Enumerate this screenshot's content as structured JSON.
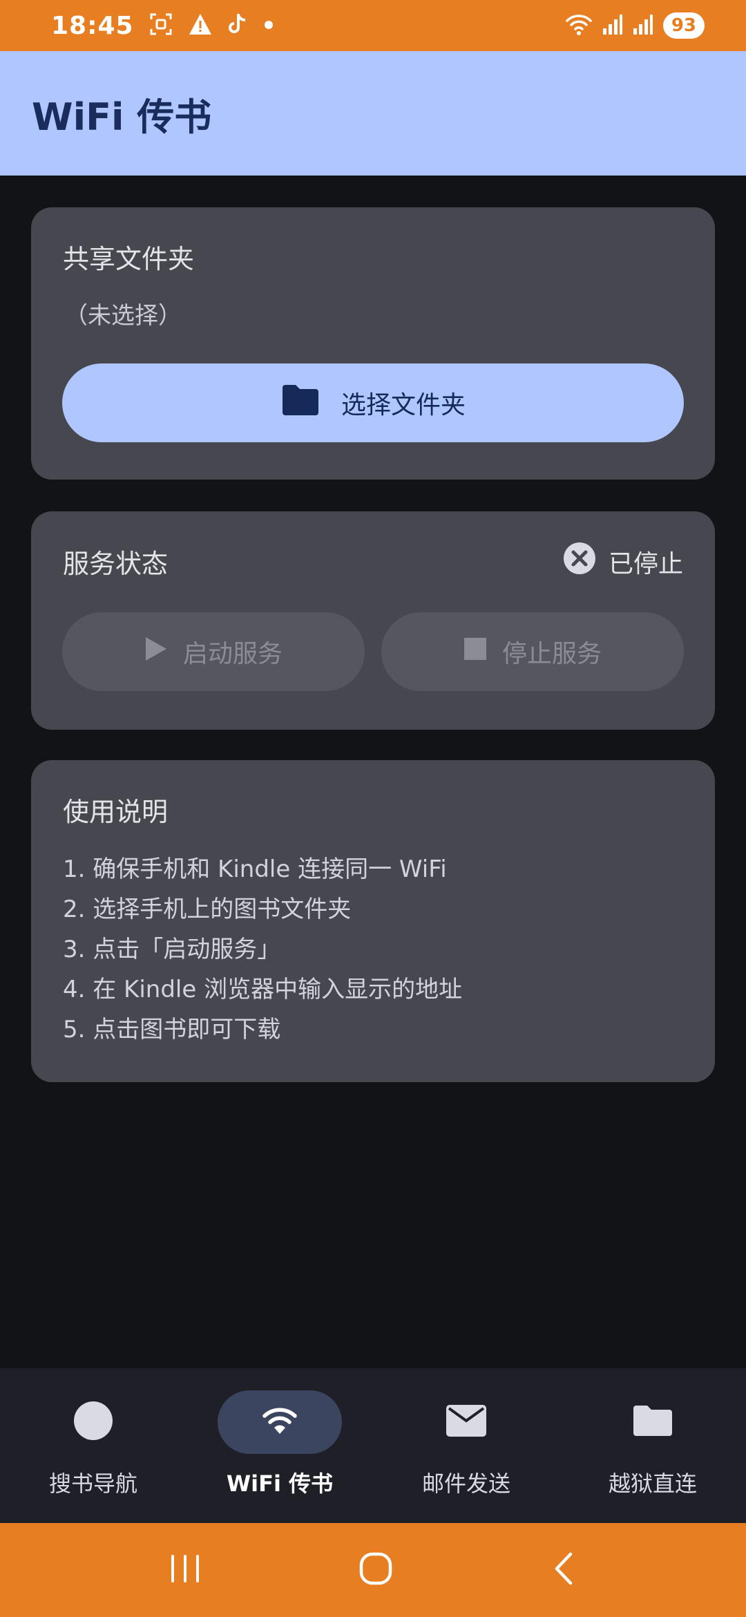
{
  "status_bar": {
    "time": "18:45",
    "battery": "93",
    "icons": [
      "screenshot-icon",
      "warning-icon",
      "tiktok-icon",
      "dot-icon",
      "wifi-icon",
      "signal-icon",
      "signal-icon",
      "battery-icon"
    ]
  },
  "app_bar": {
    "title": "WiFi 传书"
  },
  "folder_card": {
    "title": "共享文件夹",
    "status": "（未选择）",
    "button_label": "选择文件夹",
    "button_icon": "folder-icon"
  },
  "service_card": {
    "title": "服务状态",
    "status_label": "已停止",
    "status_icon": "cancel-icon",
    "start_label": "启动服务",
    "stop_label": "停止服务"
  },
  "help_card": {
    "title": "使用说明",
    "steps": [
      "1. 确保手机和 Kindle 连接同一 WiFi",
      "2. 选择手机上的图书文件夹",
      "3. 点击「启动服务」",
      "4. 在 Kindle 浏览器中输入显示的地址",
      "5. 点击图书即可下载"
    ]
  },
  "bottom_nav": {
    "items": [
      {
        "label": "搜书导航",
        "icon": "circle-icon",
        "active": false
      },
      {
        "label": "WiFi 传书",
        "icon": "wifi-icon",
        "active": true
      },
      {
        "label": "邮件发送",
        "icon": "mail-icon",
        "active": false
      },
      {
        "label": "越狱直连",
        "icon": "folder-icon",
        "active": false
      }
    ]
  },
  "colors": {
    "status_bar": "#e77f22",
    "app_bar": "#b0c6ff",
    "background": "#121317",
    "card": "#46474f",
    "primary_text": "#1a2c5c"
  }
}
